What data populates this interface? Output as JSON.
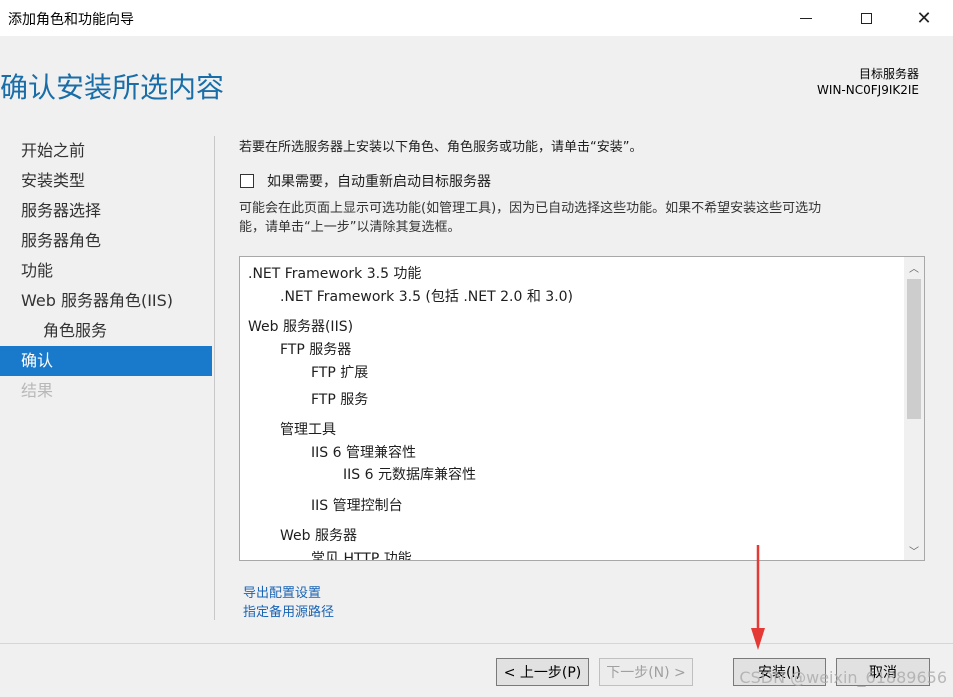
{
  "window": {
    "title": "添加角色和功能向导",
    "close_glyph": "✕"
  },
  "header": {
    "page_title": "确认安装所选内容",
    "target_label": "目标服务器",
    "target_name": "WIN-NC0FJ9IK2IE"
  },
  "nav": {
    "items": [
      {
        "label": "开始之前"
      },
      {
        "label": "安装类型"
      },
      {
        "label": "服务器选择"
      },
      {
        "label": "服务器角色"
      },
      {
        "label": "功能"
      },
      {
        "label": "Web 服务器角色(IIS)"
      },
      {
        "label": "角色服务"
      },
      {
        "label": "确认"
      },
      {
        "label": "结果"
      }
    ]
  },
  "content": {
    "instruction": "若要在所选服务器上安装以下角色、角色服务或功能，请单击“安装”。",
    "restart_label": "如果需要，自动重新启动目标服务器",
    "note_line1": "可能会在此页面上显示可选功能(如管理工具)，因为已自动选择这些功能。如果不希望安装这些可选功",
    "note_line2": "能，请单击“上一步”以清除其复选框。",
    "features": [
      {
        "text": ".NET Framework 3.5 功能"
      },
      {
        "text": ".NET Framework 3.5 (包括 .NET 2.0 和 3.0)"
      },
      {
        "text": "Web 服务器(IIS)"
      },
      {
        "text": "FTP 服务器"
      },
      {
        "text": "FTP 扩展"
      },
      {
        "text": "FTP 服务"
      },
      {
        "text": "管理工具"
      },
      {
        "text": "IIS 6 管理兼容性"
      },
      {
        "text": "IIS 6 元数据库兼容性"
      },
      {
        "text": "IIS 管理控制台"
      },
      {
        "text": "Web 服务器"
      },
      {
        "text": "常见 HTTP 功能"
      }
    ],
    "scroll_up_glyph": "︿",
    "scroll_down_glyph": "﹀",
    "link_export": "导出配置设置",
    "link_source": "指定备用源路径"
  },
  "footer": {
    "prev_label": "< 上一步(P)",
    "next_label": "下一步(N) >",
    "install_label": "安装(I)",
    "cancel_label": "取消"
  },
  "watermark": "CSDN @weixin_61889656",
  "colors": {
    "accent": "#1979ca",
    "title": "#1a6ea8",
    "link": "#1a64b4",
    "annotation_arrow": "#e53935"
  }
}
